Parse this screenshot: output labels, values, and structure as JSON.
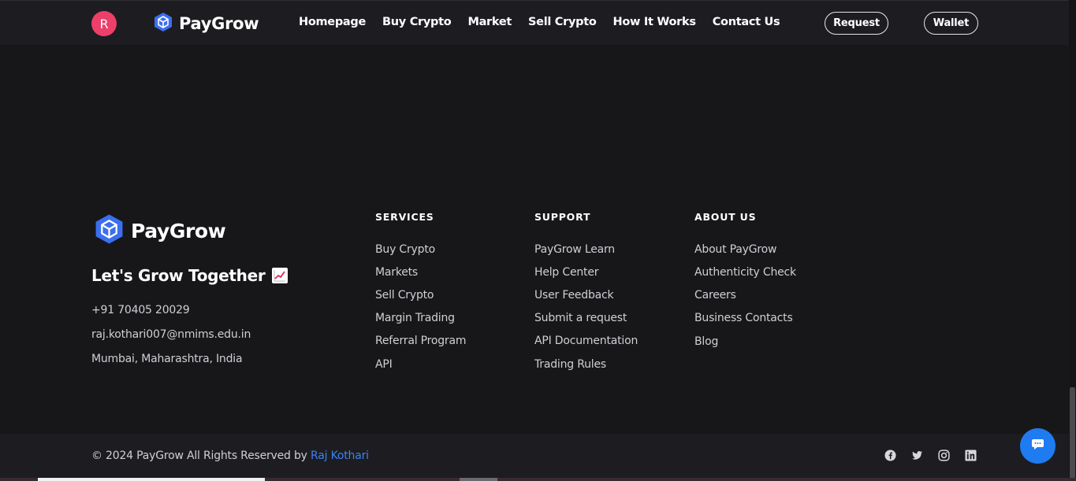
{
  "header": {
    "avatar_letter": "R",
    "brand": "PayGrow",
    "nav": [
      "Homepage",
      "Buy Crypto",
      "Market",
      "Sell Crypto",
      "How It Works",
      "Contact Us"
    ],
    "request_label": "Request",
    "wallet_label": "Wallet"
  },
  "footer": {
    "brand": "PayGrow",
    "tagline": "Let's Grow Together",
    "tagline_icon": "chart-increasing-icon",
    "phone": "+91 70405 20029",
    "email": "raj.kothari007@nmims.edu.in",
    "location": "Mumbai, Maharashtra, India",
    "columns": [
      {
        "title": "SERVICES",
        "items": [
          "Buy Crypto",
          "Markets",
          "Sell Crypto",
          "Margin Trading",
          "Referral Program",
          "API"
        ]
      },
      {
        "title": "SUPPORT",
        "items": [
          "PayGrow Learn",
          "Help Center",
          "User Feedback",
          "Submit a request",
          "API Documentation",
          "Trading Rules"
        ]
      },
      {
        "title": "ABOUT US",
        "items": [
          "About PayGrow",
          "Authenticity Check",
          "Careers",
          "Business Contacts",
          "Blog"
        ]
      }
    ],
    "copyright": "© 2024 PayGrow All Rights Reserved by",
    "author": "Raj Kothari",
    "socials": [
      "facebook-icon",
      "twitter-icon",
      "instagram-icon",
      "linkedin-icon"
    ]
  },
  "colors": {
    "background": "#17171a",
    "bar": "#1d1d21",
    "accent_blue": "#3b82f6",
    "avatar": "#ec3f6a",
    "chat_button": "#1f7bf0"
  }
}
